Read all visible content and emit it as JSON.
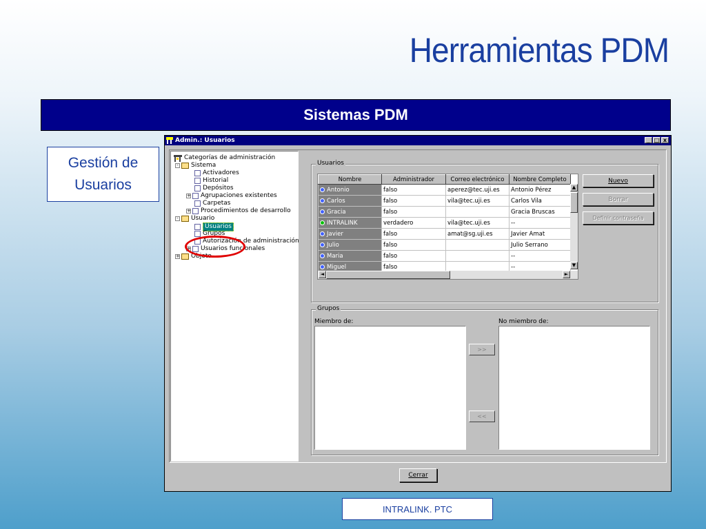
{
  "slide": {
    "title": "Herramientas PDM",
    "banner": "Sistemas PDM",
    "side_label": "Gestión de Usuarios",
    "footer": "INTRALINK. PTC"
  },
  "window": {
    "title": "Admin.: Usuarios",
    "controls": [
      "_",
      "□",
      "x"
    ],
    "tree": [
      {
        "label": "Categorías de administración",
        "icon": "admin-root-icon",
        "level": 0
      },
      {
        "label": "Sistema",
        "icon": "folder-open-icon",
        "level": 1,
        "expander": "-"
      },
      {
        "label": "Activadores",
        "icon": "document-icon",
        "level": 2
      },
      {
        "label": "Historial",
        "icon": "document-icon",
        "level": 2
      },
      {
        "label": "Depósitos",
        "icon": "document-icon",
        "level": 2
      },
      {
        "label": "Agrupaciones existentes",
        "icon": "document-icon",
        "level": 2,
        "expander": "+"
      },
      {
        "label": "Carpetas",
        "icon": "document-icon",
        "level": 2
      },
      {
        "label": "Procedimientos de desarrollo",
        "icon": "document-icon",
        "level": 2,
        "expander": "+"
      },
      {
        "label": "Usuario",
        "icon": "folder-open-icon",
        "level": 1,
        "expander": "-"
      },
      {
        "label": "Usuarios",
        "icon": "document-icon",
        "level": 2,
        "selected": true
      },
      {
        "label": "Grupos",
        "icon": "document-icon",
        "level": 2
      },
      {
        "label": "Autorización de administración",
        "icon": "document-icon",
        "level": 2
      },
      {
        "label": "Usuarios funcionales",
        "icon": "document-icon",
        "level": 2,
        "expander": "+"
      },
      {
        "label": "Objeto",
        "icon": "folder-closed-icon",
        "level": 1,
        "expander": "+"
      }
    ],
    "users_group": {
      "label": "Usuarios",
      "columns": [
        "Nombre",
        "Administrador",
        "Correo electrónico",
        "Nombre Completo"
      ],
      "rows": [
        {
          "nombre": "Antonio",
          "admin": "falso",
          "correo": "aperez@tec.uji.es",
          "completo": "Antonio Pérez",
          "icon": "blue"
        },
        {
          "nombre": "Carlos",
          "admin": "falso",
          "correo": "vila@tec.uji.es",
          "completo": "Carlos Vila",
          "icon": "blue"
        },
        {
          "nombre": "Gracia",
          "admin": "falso",
          "correo": "",
          "completo": "Gracia Bruscas",
          "icon": "blue"
        },
        {
          "nombre": "INTRALINK",
          "admin": "verdadero",
          "correo": "vila@tec.uji.es",
          "completo": "--",
          "icon": "green"
        },
        {
          "nombre": "Javier",
          "admin": "falso",
          "correo": "amat@sg.uji.es",
          "completo": "Javier Amat",
          "icon": "blue"
        },
        {
          "nombre": "Julio",
          "admin": "falso",
          "correo": "",
          "completo": "Julio Serrano",
          "icon": "blue"
        },
        {
          "nombre": "Maria",
          "admin": "falso",
          "correo": "",
          "completo": "--",
          "icon": "blue"
        },
        {
          "nombre": "Miguel",
          "admin": "falso",
          "correo": "",
          "completo": "--",
          "icon": "blue"
        }
      ],
      "buttons": {
        "nuevo": "Nuevo",
        "borrar": "Borrar",
        "definir": "Definir contraseña"
      }
    },
    "groups_group": {
      "label": "Grupos",
      "member_label": "Miembro de:",
      "non_member_label": "No miembro de:",
      "move_right": ">>",
      "move_left": "<<"
    },
    "close_button": "Cerrar"
  }
}
